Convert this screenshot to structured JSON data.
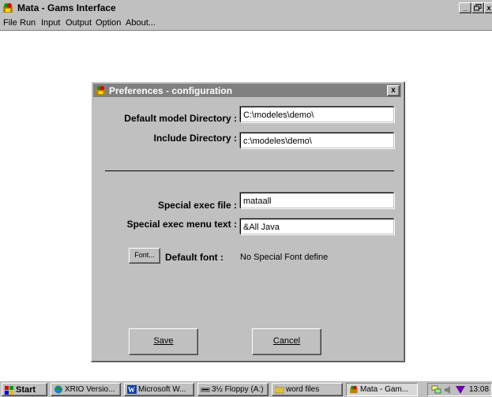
{
  "app": {
    "title": "Mata - Gams Interface",
    "menu": [
      "File",
      "Run",
      "Input",
      "Output",
      "Option",
      "About..."
    ],
    "window_buttons": [
      "_",
      "̅□",
      "x"
    ]
  },
  "dialog": {
    "title": "Preferences - configuration",
    "close_label": "x",
    "fields": {
      "default_model_dir": {
        "label": "Default model Directory :",
        "value": "C:\\modeles\\demo\\"
      },
      "include_dir": {
        "label": "Include Directory :",
        "value": "c:\\modeles\\demo\\"
      },
      "special_exec_file": {
        "label": "Special exec file :",
        "value": "mataall"
      },
      "special_exec_menu_text": {
        "label": "Special exec menu text :",
        "value": "&All Java"
      }
    },
    "font_button": "Font...",
    "default_font_label": "Default font :",
    "default_font_value": "No Special Font define",
    "save_button": "Save",
    "cancel_button": "Cancel"
  },
  "taskbar": {
    "start": "Start",
    "tasks": [
      "XRIO Versio...",
      "Microsoft W...",
      "3½ Floppy (A:)",
      "word files",
      "Mata - Gam..."
    ],
    "clock": "13:08"
  },
  "colors": {
    "dialog_title_bg": "#808080",
    "face": "#c0c0c0",
    "desktop": "#ffffff"
  }
}
